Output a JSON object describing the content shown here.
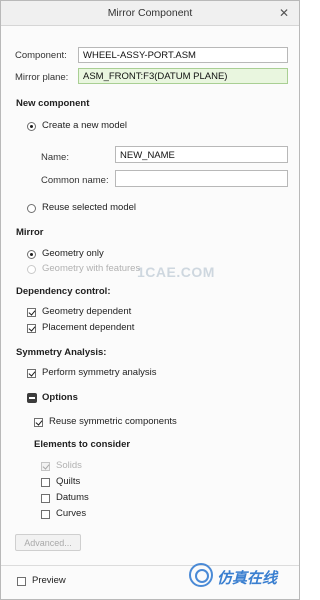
{
  "window": {
    "title": "Mirror Component"
  },
  "component": {
    "label": "Component:",
    "value": "WHEEL-ASSY-PORT.ASM"
  },
  "mirror_plane": {
    "label": "Mirror plane:",
    "value": "ASM_FRONT:F3(DATUM PLANE)"
  },
  "new_component": {
    "heading": "New component",
    "create_new": "Create a new model",
    "name_label": "Name:",
    "name_value": "NEW_NAME",
    "common_name_label": "Common name:",
    "common_name_value": "",
    "reuse": "Reuse selected model"
  },
  "mirror": {
    "heading": "Mirror",
    "geometry_only": "Geometry only",
    "geometry_with_features": "Geometry with features"
  },
  "dependency": {
    "heading": "Dependency control:",
    "geometry_dependent": "Geometry dependent",
    "placement_dependent": "Placement dependent"
  },
  "symmetry": {
    "heading": "Symmetry Analysis:",
    "perform": "Perform symmetry analysis",
    "options_heading": "Options",
    "reuse_symmetric": "Reuse symmetric components",
    "elements_heading": "Elements to consider",
    "solids": "Solids",
    "quilts": "Quilts",
    "datums": "Datums",
    "curves": "Curves",
    "advanced_button": "Advanced..."
  },
  "preview": {
    "label": "Preview"
  },
  "watermarks": {
    "main": "1CAE.COM",
    "bottom": "仿真在线"
  },
  "colors": {
    "accent_green": "#e9f6df",
    "disabled_text": "#b1b1b1",
    "watermark_blue": "#3a7fd0"
  }
}
